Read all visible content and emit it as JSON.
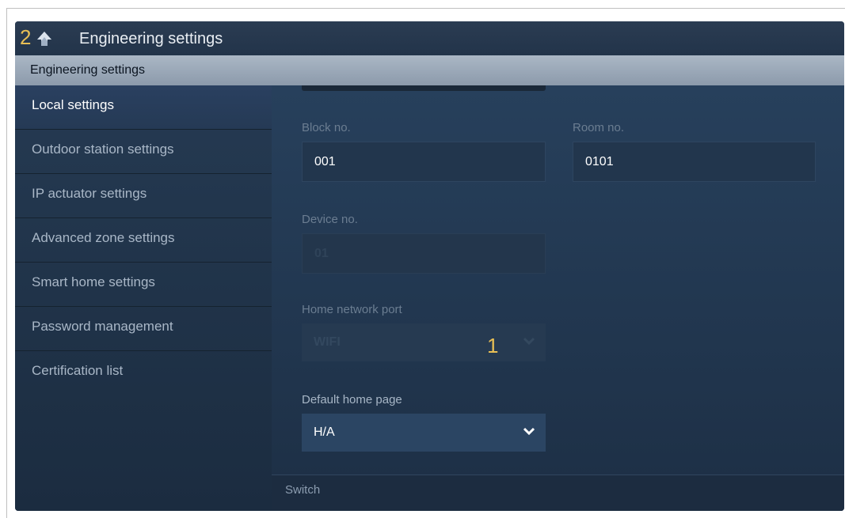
{
  "annotations": {
    "title_marker": "2",
    "field_marker": "1"
  },
  "header": {
    "title": "Engineering settings"
  },
  "section_header": "Engineering settings",
  "sidebar": {
    "items": [
      {
        "label": "Local settings",
        "active": true
      },
      {
        "label": "Outdoor station settings"
      },
      {
        "label": "IP actuator settings"
      },
      {
        "label": "Advanced zone settings"
      },
      {
        "label": "Smart home settings"
      },
      {
        "label": "Password management"
      },
      {
        "label": "Certification list"
      }
    ]
  },
  "form": {
    "block_no": {
      "label": "Block no.",
      "value": "001"
    },
    "room_no": {
      "label": "Room no.",
      "value": "0101"
    },
    "device_no": {
      "label": "Device no.",
      "value": "01"
    },
    "home_network_port": {
      "label": "Home network port",
      "value": "WIFI"
    },
    "default_home_page": {
      "label": "Default home page",
      "value": "H/A"
    }
  },
  "footer": {
    "switch_label": "Switch"
  },
  "colors": {
    "annotation": "#e8bf55",
    "header_bar": "#9aa8b8",
    "background": "#1f2f43"
  }
}
